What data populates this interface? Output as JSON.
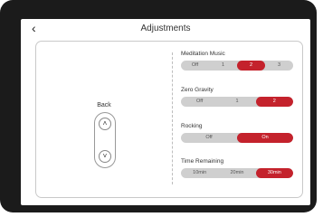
{
  "header": {
    "back_glyph": "‹",
    "title": "Adjustments"
  },
  "left": {
    "label": "Back",
    "up_glyph": "˄",
    "down_glyph": "˅"
  },
  "sections": [
    {
      "label": "Meditation Music",
      "options": [
        "Off",
        "1",
        "2",
        "3"
      ],
      "selected": "2"
    },
    {
      "label": "Zero Gravity",
      "options": [
        "Off",
        "1",
        "2"
      ],
      "selected": "2"
    },
    {
      "label": "Rocking",
      "options": [
        "Off",
        "On"
      ],
      "selected": "On"
    },
    {
      "label": "Time Remaining",
      "options": [
        "10min",
        "20min",
        "30min"
      ],
      "selected": "30min"
    }
  ],
  "colors": {
    "accent": "#c4222c",
    "segment_bg": "#cfcfcf",
    "bezel": "#1b1b1b"
  }
}
